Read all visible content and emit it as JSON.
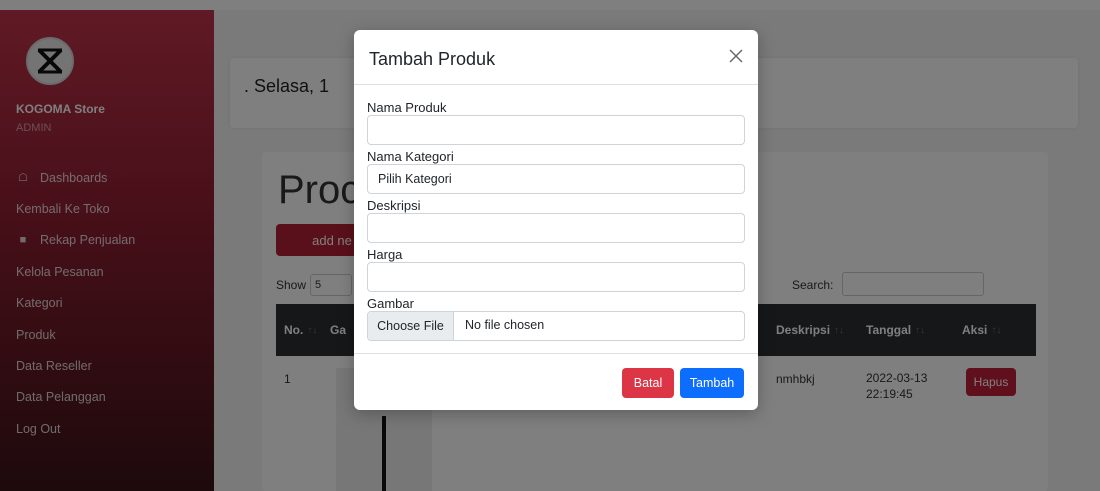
{
  "sidebar": {
    "brand": "KOGOMA Store",
    "role": "ADMIN",
    "logo_icon": "crossed-logo-icon",
    "items": [
      {
        "label": "Dashboards",
        "icon": "home-icon"
      },
      {
        "label": "Kembali Ke Toko",
        "icon": ""
      },
      {
        "label": "Rekap Penjualan",
        "icon": "book-icon"
      },
      {
        "label": "Kelola Pesanan",
        "icon": ""
      },
      {
        "label": "Kategori",
        "icon": ""
      },
      {
        "label": "Produk",
        "icon": ""
      },
      {
        "label": "Data Reseller",
        "icon": ""
      },
      {
        "label": "Data Pelanggan",
        "icon": ""
      },
      {
        "label": "Log Out",
        "icon": ""
      }
    ]
  },
  "main": {
    "date_text": ". Selasa, 1",
    "page_heading": "Proc",
    "add_button": "add ne",
    "show_label": "Show",
    "show_value": "5",
    "search_label": "Search:",
    "table": {
      "headers": [
        "No.",
        "Ga",
        "Deskripsi",
        "Tanggal",
        "Aksi"
      ],
      "rows": [
        {
          "no": "1",
          "deskripsi": "nmhbkj",
          "tanggal": "2022-03-13 22:19:45",
          "aksi": "Hapus"
        }
      ]
    }
  },
  "modal": {
    "title": "Tambah Produk",
    "fields": {
      "nama_produk_label": "Nama Produk",
      "nama_produk_value": "",
      "nama_kategori_label": "Nama Kategori",
      "nama_kategori_value": "Pilih Kategori",
      "deskripsi_label": "Deskripsi",
      "deskripsi_value": "",
      "harga_label": "Harga",
      "harga_value": "",
      "gambar_label": "Gambar",
      "file_button": "Choose File",
      "file_status": "No file chosen"
    },
    "buttons": {
      "cancel": "Batal",
      "submit": "Tambah"
    }
  },
  "colors": {
    "sidebar_top": "#c0334a",
    "sidebar_bottom": "#3a1418",
    "danger": "#dc3545",
    "primary": "#0d6efd"
  }
}
